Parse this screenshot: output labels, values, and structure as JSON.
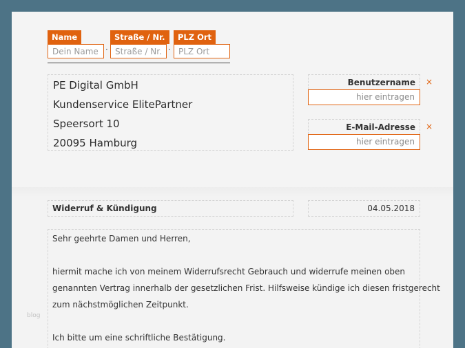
{
  "sender": {
    "name": {
      "label": "Name",
      "placeholder": "Dein Name"
    },
    "street": {
      "label": "Straße / Nr.",
      "placeholder": "Straße / Nr."
    },
    "city": {
      "label": "PLZ Ort",
      "placeholder": "PLZ Ort"
    },
    "separator": "·"
  },
  "recipient": {
    "lines": [
      "PE Digital GmbH",
      "Kundenservice ElitePartner",
      "Speersort 10",
      "20095 Hamburg"
    ]
  },
  "fields": {
    "username": {
      "label": "Benutzername",
      "placeholder": "hier eintragen",
      "required_mark": "×"
    },
    "email": {
      "label": "E-Mail-Adresse",
      "placeholder": "hier eintragen",
      "required_mark": "×"
    }
  },
  "subject": "Widerruf & Kündigung",
  "date": "04.05.2018",
  "letter": {
    "greeting": "Sehr geehrte Damen und Herren,",
    "paragraph1": [
      "hiermit mache ich von meinem Widerrufsrecht Gebrauch und widerrufe meinen oben",
      "genannten Vertrag innerhalb der gesetzlichen Frist. Hilfsweise kündige ich diesen fristgerecht",
      "zum nächstmöglichen Zeitpunkt."
    ],
    "paragraph2": "Ich bitte um eine schriftliche Bestätigung."
  },
  "watermark": "blog",
  "colors": {
    "accent": "#e0620f",
    "frame": "#4d7386"
  }
}
